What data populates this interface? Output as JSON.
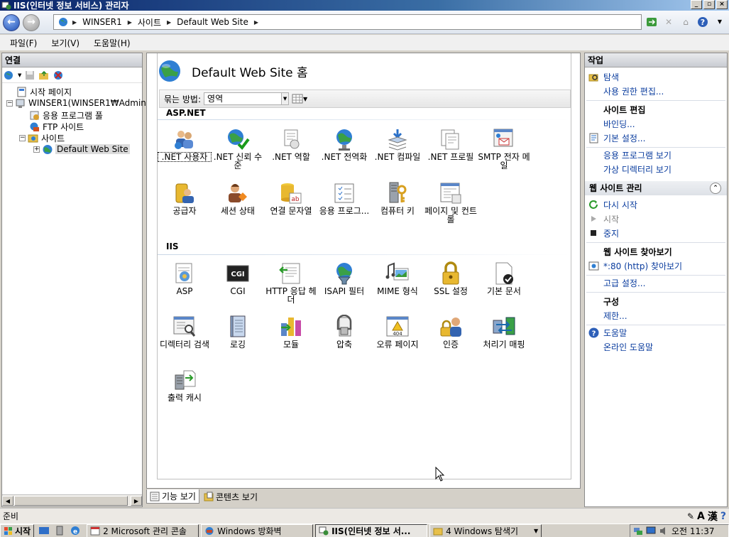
{
  "window": {
    "title": "IIS(인터넷 정보 서비스) 관리자",
    "controls": [
      "_",
      "▫",
      "×"
    ]
  },
  "nav": {
    "breadcrumbs": [
      "WINSER1",
      "사이트",
      "Default Web Site"
    ]
  },
  "menu": {
    "items": [
      "파일(F)",
      "보기(V)",
      "도움말(H)"
    ]
  },
  "connections": {
    "header": "연결",
    "tree": [
      {
        "label": "시작 페이지"
      },
      {
        "label": "WINSER1(WINSER1₩Admin"
      },
      {
        "label": "응용 프로그램 풀"
      },
      {
        "label": "FTP 사이트"
      },
      {
        "label": "사이트"
      },
      {
        "label": "Default Web Site"
      }
    ]
  },
  "main": {
    "title": "Default Web Site 홈",
    "group_by_label": "묶는 방법:",
    "group_by_value": "영역",
    "sections": [
      {
        "title": "ASP.NET",
        "features": [
          {
            "label": ".NET 사용자",
            "icon": "users-icon"
          },
          {
            "label": ".NET 신뢰 수준",
            "icon": "trust-globe-icon"
          },
          {
            "label": ".NET 역할",
            "icon": "role-icon"
          },
          {
            "label": ".NET 전역화",
            "icon": "globalization-icon"
          },
          {
            "label": ".NET 컴파일",
            "icon": "compile-icon"
          },
          {
            "label": ".NET 프로필",
            "icon": "profile-icon"
          },
          {
            "label": "SMTP 전자 메일",
            "icon": "smtp-icon"
          },
          {
            "label": "공급자",
            "icon": "providers-icon"
          },
          {
            "label": "세션 상태",
            "icon": "session-icon"
          },
          {
            "label": "연결 문자열",
            "icon": "connection-string-icon"
          },
          {
            "label": "응용 프로그...",
            "icon": "app-settings-icon"
          },
          {
            "label": "컴퓨터 키",
            "icon": "machine-key-icon"
          },
          {
            "label": "페이지 및 컨트롤",
            "icon": "pages-controls-icon"
          }
        ]
      },
      {
        "title": "IIS",
        "features": [
          {
            "label": "ASP",
            "icon": "asp-icon"
          },
          {
            "label": "CGI",
            "icon": "cgi-icon"
          },
          {
            "label": "HTTP 응답 헤더",
            "icon": "http-headers-icon"
          },
          {
            "label": "ISAPI 필터",
            "icon": "isapi-filter-icon"
          },
          {
            "label": "MIME 형식",
            "icon": "mime-icon"
          },
          {
            "label": "SSL 설정",
            "icon": "ssl-lock-icon"
          },
          {
            "label": "기본 문서",
            "icon": "default-document-icon"
          },
          {
            "label": "디렉터리 검색",
            "icon": "directory-browse-icon"
          },
          {
            "label": "로깅",
            "icon": "logging-icon"
          },
          {
            "label": "모듈",
            "icon": "modules-icon"
          },
          {
            "label": "압축",
            "icon": "compression-icon"
          },
          {
            "label": "오류 페이지",
            "icon": "error-pages-icon"
          },
          {
            "label": "인증",
            "icon": "authentication-icon"
          },
          {
            "label": "처리기 매핑",
            "icon": "handler-mappings-icon"
          },
          {
            "label": "출력 캐시",
            "icon": "output-cache-icon"
          }
        ]
      }
    ]
  },
  "bottom_tabs": [
    "기능 보기",
    "콘텐츠 보기"
  ],
  "actions": {
    "header": "작업",
    "explore": "탐색",
    "edit_permissions": "사용 권한 편집...",
    "edit_site_head": "사이트 편집",
    "bindings": "바인딩...",
    "basic_settings": "기본 설정...",
    "view_apps": "응용 프로그램 보기",
    "view_vdirs": "가상 디렉터리 보기",
    "manage_head": "웹 사이트 관리",
    "restart": "다시 시작",
    "start": "시작",
    "stop": "중지",
    "browse_head": "웹 사이트 찾아보기",
    "browse_http": "*:80 (http) 찾아보기",
    "advanced_settings": "고급 설정...",
    "config_head": "구성",
    "limits": "제한...",
    "help": "도움말",
    "online_help": "온라인 도움말"
  },
  "status": {
    "text": "준비"
  },
  "taskbar": {
    "start": "시작",
    "tasks": [
      "2 Microsoft 관리 콘솔",
      "Windows 방화벽",
      "IIS(인터넷 정보 서...",
      "4 Windows 탐색기"
    ],
    "clock": "오전 11:37"
  },
  "colors": {
    "link": "#0a3c9e",
    "title_bar": "#0a246a"
  }
}
